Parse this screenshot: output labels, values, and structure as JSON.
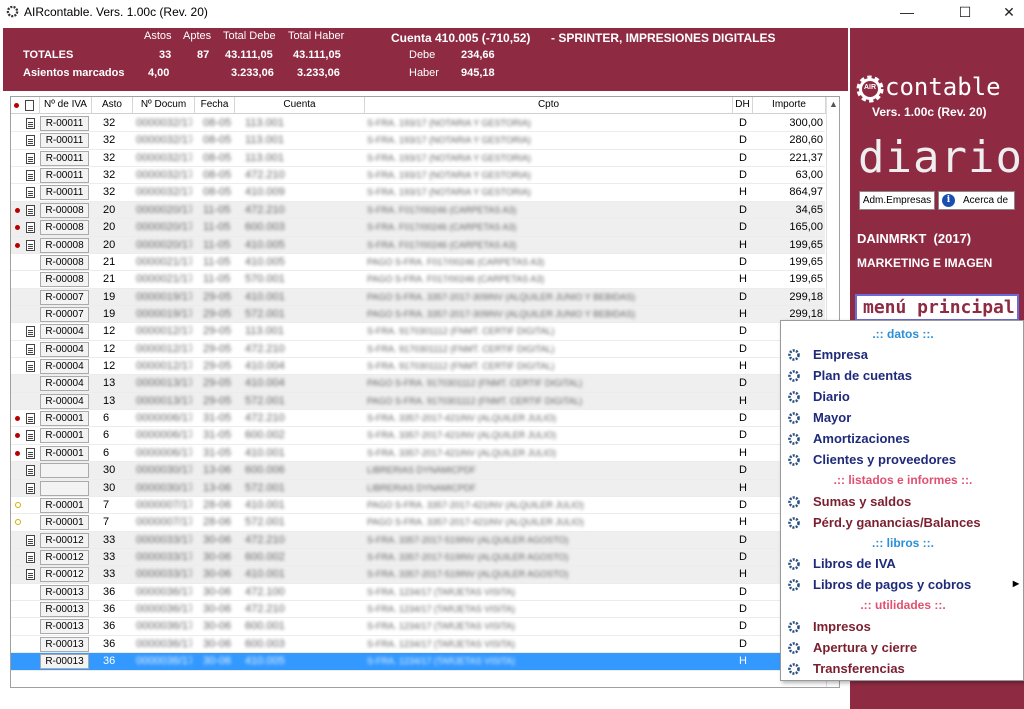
{
  "window": {
    "title": "AIRcontable. Vers. 1.00c (Rev. 20)",
    "min": "—",
    "max": "☐",
    "close": "✕"
  },
  "header": {
    "col_astos": "Astos",
    "col_aptes": "Aptes",
    "col_total_debe": "Total Debe",
    "col_total_haber": "Total Haber",
    "totales_label": "TOTALES",
    "totales_astos": "33",
    "totales_aptes": "87",
    "totales_debe": "43.111,05",
    "totales_haber": "43.111,05",
    "marcados_label": "Asientos marcados",
    "marcados_astos": "4,00",
    "marcados_debe": "3.233,06",
    "marcados_haber": "3.233,06",
    "cuenta": "Cuenta 410.005 (-710,52)",
    "cuenta_desc": "- SPRINTER, IMPRESIONES DIGITALES",
    "debe_label": "Debe",
    "debe_value": "234,66",
    "haber_label": "Haber",
    "haber_value": "945,18"
  },
  "brand": {
    "logo_text": "contable",
    "logo_mark": "AIR",
    "version": "Vers. 1.00c (Rev. 20)",
    "section": "diario",
    "btn_empresas": "Adm.Empresas",
    "btn_acerca": "Acerca de",
    "company": "DAINMRKT  (2017)",
    "company_desc": "MARKETING E IMAGEN",
    "menu_title": "menú principal"
  },
  "grid": {
    "headers": {
      "iva": "Nº de IVA",
      "asto": "Asto",
      "docum": "Nº Docum",
      "fecha": "Fecha",
      "cuenta": "Cuenta",
      "cpto": "Cpto",
      "dh": "DH",
      "importe": "Importe"
    },
    "rows": [
      {
        "mark": "",
        "doc": true,
        "iva": "R-00011",
        "asto": "32",
        "docum": "0000032/17",
        "fecha": "08-05",
        "cuenta": "113.001",
        "cpto": "S-FRA. 193/17 (NOTARIA Y GESTORIA)",
        "dh": "D",
        "importe": "300,00",
        "shade": false
      },
      {
        "mark": "",
        "doc": true,
        "iva": "R-00011",
        "asto": "32",
        "docum": "0000032/17",
        "fecha": "08-05",
        "cuenta": "113.001",
        "cpto": "S-FRA. 193/17 (NOTARIA Y GESTORIA)",
        "dh": "D",
        "importe": "280,60",
        "shade": false
      },
      {
        "mark": "",
        "doc": true,
        "iva": "R-00011",
        "asto": "32",
        "docum": "0000032/17",
        "fecha": "08-05",
        "cuenta": "113.001",
        "cpto": "S-FRA. 193/17 (NOTARIA Y GESTORIA)",
        "dh": "D",
        "importe": "221,37",
        "shade": false
      },
      {
        "mark": "",
        "doc": true,
        "iva": "R-00011",
        "asto": "32",
        "docum": "0000032/17",
        "fecha": "08-05",
        "cuenta": "472.210",
        "cpto": "S-FRA. 193/17 (NOTARIA Y GESTORIA)",
        "dh": "D",
        "importe": "63,00",
        "shade": false
      },
      {
        "mark": "",
        "doc": true,
        "iva": "R-00011",
        "asto": "32",
        "docum": "0000032/17",
        "fecha": "08-05",
        "cuenta": "410.009",
        "cpto": "S-FRA. 193/17 (NOTARIA Y GESTORIA)",
        "dh": "H",
        "importe": "864,97",
        "shade": false
      },
      {
        "mark": "red",
        "doc": true,
        "iva": "R-00008",
        "asto": "20",
        "docum": "0000020/17",
        "fecha": "11-05",
        "cuenta": "472.210",
        "cpto": "S-FRA. F017/00246 (CARPETAS A3)",
        "dh": "D",
        "importe": "34,65",
        "shade": true
      },
      {
        "mark": "red",
        "doc": true,
        "iva": "R-00008",
        "asto": "20",
        "docum": "0000020/17",
        "fecha": "11-05",
        "cuenta": "600.003",
        "cpto": "S-FRA. F017/00246 (CARPETAS A3)",
        "dh": "D",
        "importe": "165,00",
        "shade": true
      },
      {
        "mark": "red",
        "doc": true,
        "iva": "R-00008",
        "asto": "20",
        "docum": "0000020/17",
        "fecha": "11-05",
        "cuenta": "410.005",
        "cpto": "S-FRA. F017/00246 (CARPETAS A3)",
        "dh": "H",
        "importe": "199,65",
        "shade": true
      },
      {
        "mark": "",
        "doc": false,
        "iva": "R-00008",
        "asto": "21",
        "docum": "0000021/17",
        "fecha": "11-05",
        "cuenta": "410.005",
        "cpto": "PAGO S-FRA. F017/00246 (CARPETAS A3)",
        "dh": "D",
        "importe": "199,65",
        "shade": false
      },
      {
        "mark": "",
        "doc": false,
        "iva": "R-00008",
        "asto": "21",
        "docum": "0000021/17",
        "fecha": "11-05",
        "cuenta": "570.001",
        "cpto": "PAGO S-FRA. F017/00246 (CARPETAS A3)",
        "dh": "H",
        "importe": "199,65",
        "shade": false
      },
      {
        "mark": "",
        "doc": false,
        "iva": "R-00007",
        "asto": "19",
        "docum": "0000019/17",
        "fecha": "29-05",
        "cuenta": "410.001",
        "cpto": "PAGO S-FRA. 3357-2017-309INV (ALQUILER JUNIO Y BEBIDAS)",
        "dh": "D",
        "importe": "299,18",
        "shade": true
      },
      {
        "mark": "",
        "doc": false,
        "iva": "R-00007",
        "asto": "19",
        "docum": "0000019/17",
        "fecha": "29-05",
        "cuenta": "572.001",
        "cpto": "PAGO S-FRA. 3357-2017-309INV (ALQUILER JUNIO Y BEBIDAS)",
        "dh": "H",
        "importe": "299,18",
        "shade": true
      },
      {
        "mark": "",
        "doc": true,
        "iva": "R-00004",
        "asto": "12",
        "docum": "0000012/17",
        "fecha": "29-05",
        "cuenta": "113.001",
        "cpto": "S-FRA. 9170301112 (FNMT. CERTIF DIGITAL)",
        "dh": "D",
        "importe": "",
        "shade": false
      },
      {
        "mark": "",
        "doc": true,
        "iva": "R-00004",
        "asto": "12",
        "docum": "0000012/17",
        "fecha": "29-05",
        "cuenta": "472.210",
        "cpto": "S-FRA. 9170301112 (FNMT. CERTIF DIGITAL)",
        "dh": "D",
        "importe": "",
        "shade": false
      },
      {
        "mark": "",
        "doc": true,
        "iva": "R-00004",
        "asto": "12",
        "docum": "0000012/17",
        "fecha": "29-05",
        "cuenta": "410.004",
        "cpto": "S-FRA. 9170301112 (FNMT. CERTIF DIGITAL)",
        "dh": "H",
        "importe": "",
        "shade": false
      },
      {
        "mark": "",
        "doc": false,
        "iva": "R-00004",
        "asto": "13",
        "docum": "0000013/17",
        "fecha": "29-05",
        "cuenta": "410.004",
        "cpto": "PAGO S-FRA. 9170301112 (FNMT. CERTIF DIGITAL)",
        "dh": "D",
        "importe": "",
        "shade": true
      },
      {
        "mark": "",
        "doc": false,
        "iva": "R-00004",
        "asto": "13",
        "docum": "0000013/17",
        "fecha": "29-05",
        "cuenta": "572.001",
        "cpto": "PAGO S-FRA. 9170301112 (FNMT. CERTIF DIGITAL)",
        "dh": "H",
        "importe": "",
        "shade": true
      },
      {
        "mark": "red",
        "doc": true,
        "iva": "R-00001",
        "asto": "6",
        "docum": "0000006/17",
        "fecha": "31-05",
        "cuenta": "472.210",
        "cpto": "S-FRA. 3357-2017-421INV (ALQUILER JULIO)",
        "dh": "D",
        "importe": "",
        "shade": false
      },
      {
        "mark": "red",
        "doc": true,
        "iva": "R-00001",
        "asto": "6",
        "docum": "0000006/17",
        "fecha": "31-05",
        "cuenta": "600.002",
        "cpto": "S-FRA. 3357-2017-421INV (ALQUILER JULIO)",
        "dh": "D",
        "importe": "",
        "shade": false
      },
      {
        "mark": "red",
        "doc": true,
        "iva": "R-00001",
        "asto": "6",
        "docum": "0000006/17",
        "fecha": "31-05",
        "cuenta": "410.001",
        "cpto": "S-FRA. 3357-2017-421INV (ALQUILER JULIO)",
        "dh": "H",
        "importe": "",
        "shade": false
      },
      {
        "mark": "",
        "doc": true,
        "iva": "",
        "asto": "30",
        "docum": "0000030/17",
        "fecha": "13-06",
        "cuenta": "600.006",
        "cpto": "LIBRERIAS DYNAMICPDF",
        "dh": "D",
        "importe": "",
        "shade": true
      },
      {
        "mark": "",
        "doc": true,
        "iva": "",
        "asto": "30",
        "docum": "0000030/17",
        "fecha": "13-06",
        "cuenta": "572.001",
        "cpto": "LIBRERIAS DYNAMICPDF",
        "dh": "H",
        "importe": "",
        "shade": true
      },
      {
        "mark": "yellow",
        "doc": false,
        "iva": "R-00001",
        "asto": "7",
        "docum": "0000007/17",
        "fecha": "28-06",
        "cuenta": "410.001",
        "cpto": "PAGO S-FRA. 3357-2017-421INV (ALQUILER JULIO)",
        "dh": "D",
        "importe": "",
        "shade": false
      },
      {
        "mark": "yellow",
        "doc": false,
        "iva": "R-00001",
        "asto": "7",
        "docum": "0000007/17",
        "fecha": "28-06",
        "cuenta": "572.001",
        "cpto": "PAGO S-FRA. 3357-2017-421INV (ALQUILER JULIO)",
        "dh": "H",
        "importe": "",
        "shade": false
      },
      {
        "mark": "",
        "doc": true,
        "iva": "R-00012",
        "asto": "33",
        "docum": "0000033/17",
        "fecha": "30-06",
        "cuenta": "472.210",
        "cpto": "S-FRA. 3357-2017-519INV (ALQUILER AGOSTO)",
        "dh": "D",
        "importe": "",
        "shade": true
      },
      {
        "mark": "",
        "doc": true,
        "iva": "R-00012",
        "asto": "33",
        "docum": "0000033/17",
        "fecha": "30-06",
        "cuenta": "600.002",
        "cpto": "S-FRA. 3357-2017-519INV (ALQUILER AGOSTO)",
        "dh": "D",
        "importe": "",
        "shade": true
      },
      {
        "mark": "",
        "doc": true,
        "iva": "R-00012",
        "asto": "33",
        "docum": "0000033/17",
        "fecha": "30-06",
        "cuenta": "410.001",
        "cpto": "S-FRA. 3357-2017-519INV (ALQUILER AGOSTO)",
        "dh": "H",
        "importe": "",
        "shade": true
      },
      {
        "mark": "",
        "doc": false,
        "iva": "R-00013",
        "asto": "36",
        "docum": "0000036/17",
        "fecha": "30-06",
        "cuenta": "472.100",
        "cpto": "S-FRA. 1234/17 (TARJETAS VISITA)",
        "dh": "D",
        "importe": "",
        "shade": false
      },
      {
        "mark": "",
        "doc": false,
        "iva": "R-00013",
        "asto": "36",
        "docum": "0000036/17",
        "fecha": "30-06",
        "cuenta": "472.210",
        "cpto": "S-FRA. 1234/17 (TARJETAS VISITA)",
        "dh": "D",
        "importe": "",
        "shade": false
      },
      {
        "mark": "",
        "doc": false,
        "iva": "R-00013",
        "asto": "36",
        "docum": "0000036/17",
        "fecha": "30-06",
        "cuenta": "600.001",
        "cpto": "S-FRA. 1234/17 (TARJETAS VISITA)",
        "dh": "D",
        "importe": "",
        "shade": false
      },
      {
        "mark": "",
        "doc": false,
        "iva": "R-00013",
        "asto": "36",
        "docum": "0000036/17",
        "fecha": "30-06",
        "cuenta": "600.003",
        "cpto": "S-FRA. 1234/17 (TARJETAS VISITA)",
        "dh": "D",
        "importe": "",
        "shade": false
      },
      {
        "mark": "",
        "doc": false,
        "iva": "R-00013",
        "asto": "36",
        "docum": "0000036/17",
        "fecha": "30-06",
        "cuenta": "410.005",
        "cpto": "S-FRA. 1234/17 (TARJETAS VISITA)",
        "dh": "H",
        "importe": "",
        "shade": false,
        "selected": true
      }
    ]
  },
  "menu": {
    "sec_datos": ".:: datos ::.",
    "sec_listados": ".:: listados e informes ::.",
    "sec_libros": ".:: libros ::.",
    "sec_utilidades": ".:: utilidades ::.",
    "items": [
      {
        "label": "Empresa",
        "color": "#1f2a7a"
      },
      {
        "label": "Plan de cuentas",
        "color": "#1f2a7a"
      },
      {
        "label": "Diario",
        "color": "#1f2a7a"
      },
      {
        "label": "Mayor",
        "color": "#1f2a7a"
      },
      {
        "label": "Amortizaciones",
        "color": "#1f2a7a"
      },
      {
        "label": "Clientes y proveedores",
        "color": "#1f2a7a"
      },
      {
        "label": "Sumas y saldos",
        "color": "#7a1f2f"
      },
      {
        "label": "Pérd.y ganancias/Balances",
        "color": "#7a1f2f"
      },
      {
        "label": "Libros de IVA",
        "color": "#1f2a7a"
      },
      {
        "label": "Libros de pagos y cobros",
        "color": "#1f2a7a"
      },
      {
        "label": "Impresos",
        "color": "#7a1f2f"
      },
      {
        "label": "Apertura y cierre",
        "color": "#7a1f2f"
      },
      {
        "label": "Transferencias",
        "color": "#7a1f2f"
      }
    ]
  },
  "colors": {
    "brand": "#8e2b43",
    "section_blue": "#2a8fd6",
    "section_pink": "#e05070",
    "selected_row": "#3399ff"
  }
}
